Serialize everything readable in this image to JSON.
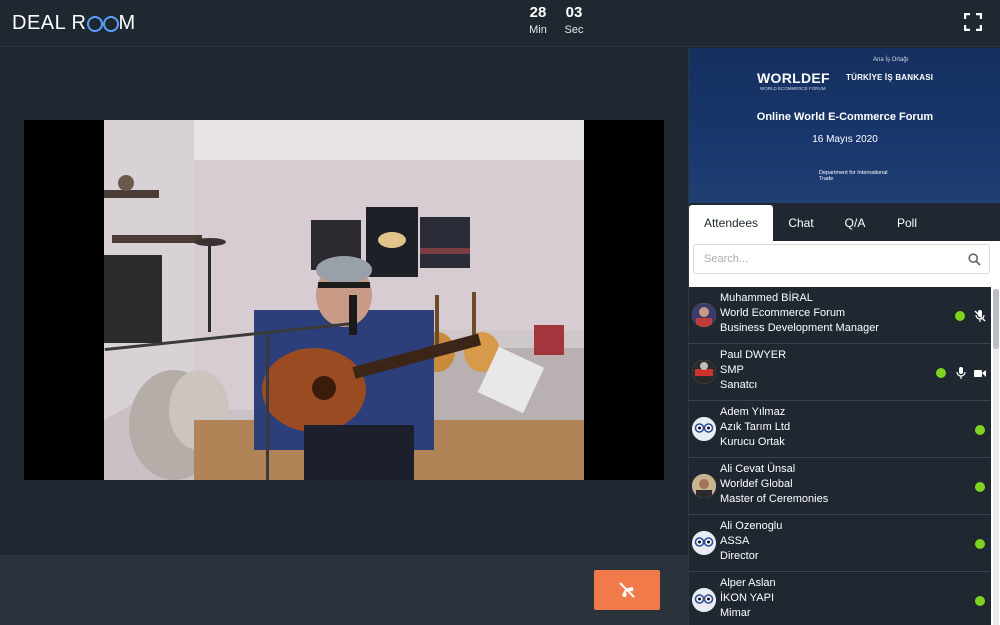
{
  "app": {
    "logo_left": "DEAL R",
    "logo_right": "M"
  },
  "timer": {
    "minutes": "28",
    "minutes_label": "Min",
    "seconds": "03",
    "seconds_label": "Sec"
  },
  "banner": {
    "partner_label": "Ana İş Ortağı",
    "worldef": "WORLDEF",
    "worldef_sub": "WORLD ECOMMERCE FORUM",
    "bank": "TÜRKİYE İŞ BANKASI",
    "event_title": "Online World E-Commerce Forum",
    "event_date": "16 Mayıs 2020",
    "dit": "Department for International Trade"
  },
  "tabs": [
    {
      "label": "Attendees",
      "active": true
    },
    {
      "label": "Chat"
    },
    {
      "label": "Q/A"
    },
    {
      "label": "Poll"
    }
  ],
  "search": {
    "placeholder": "Search..."
  },
  "attendees": [
    {
      "name": "Muhammed BİRAL",
      "company": "World Ecommerce Forum",
      "title": "Business Development Manager",
      "online": true,
      "icons": [
        "mic-muted-icon"
      ]
    },
    {
      "name": "Paul DWYER",
      "company": "SMP",
      "title": "Sanatcı",
      "online": true,
      "icons": [
        "mic-icon",
        "camera-icon"
      ]
    },
    {
      "name": "Adem Yılmaz",
      "company": "Azık Tarım Ltd",
      "title": "Kurucu Ortak",
      "online": true,
      "icons": []
    },
    {
      "name": "Ali Cevat Ünsal",
      "company": "Worldef Global",
      "title": "Master of Ceremonies",
      "online": true,
      "icons": []
    },
    {
      "name": "Ali Ozenoglu",
      "company": "ASSA",
      "title": "Director",
      "online": true,
      "icons": []
    },
    {
      "name": "Alper Aslan",
      "company": "İKON YAPI",
      "title": "Mimar",
      "online": true,
      "icons": []
    }
  ],
  "colors": {
    "background": "#1f2731",
    "accent_end_call": "#f17a4a",
    "online": "#7ed321"
  }
}
